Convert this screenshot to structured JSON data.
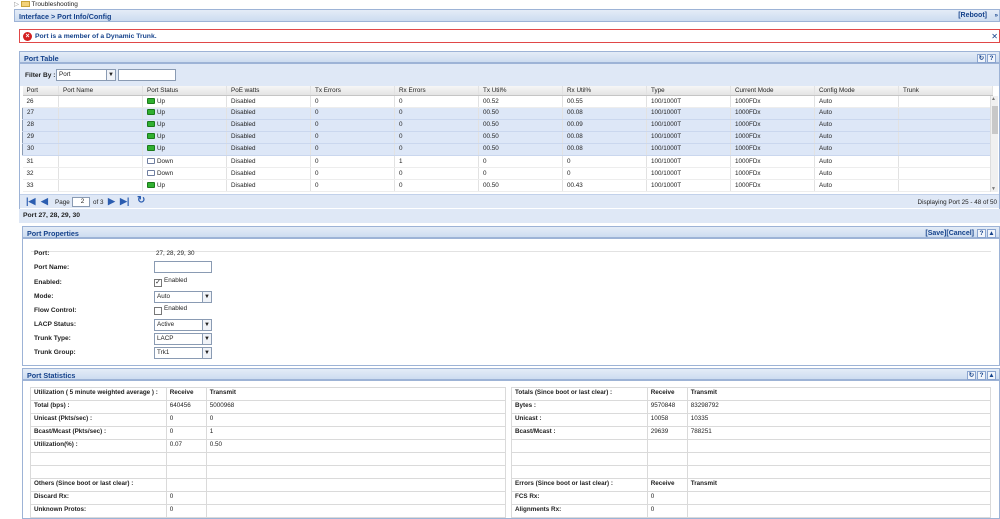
{
  "tree": {
    "item": "Troubleshooting"
  },
  "header": {
    "breadcrumb": "Interface > Port Info/Config",
    "reboot": "[Reboot]"
  },
  "alert": {
    "message": "Port is a member of a Dynamic Trunk."
  },
  "port_table": {
    "title": "Port Table",
    "filter_label": "Filter By :",
    "filter_value": "Port",
    "columns": [
      "Port",
      "Port Name",
      "Port Status",
      "PoE watts",
      "Tx Errors",
      "Rx Errors",
      "Tx Util%",
      "Rx Util%",
      "Type",
      "Current Mode",
      "Config Mode",
      "Trunk"
    ],
    "rows": [
      {
        "port": "26",
        "name": "",
        "status": "Up",
        "poe": "Disabled",
        "tx_err": "0",
        "rx_err": "0",
        "tx_util": "00.52",
        "rx_util": "00.55",
        "type": "100/1000T",
        "cur": "1000FDx",
        "cfg": "Auto",
        "trunk": "",
        "selected": false
      },
      {
        "port": "27",
        "name": "",
        "status": "Up",
        "poe": "Disabled",
        "tx_err": "0",
        "rx_err": "0",
        "tx_util": "00.50",
        "rx_util": "00.08",
        "type": "100/1000T",
        "cur": "1000FDx",
        "cfg": "Auto",
        "trunk": "",
        "selected": true
      },
      {
        "port": "28",
        "name": "",
        "status": "Up",
        "poe": "Disabled",
        "tx_err": "0",
        "rx_err": "0",
        "tx_util": "00.50",
        "rx_util": "00.09",
        "type": "100/1000T",
        "cur": "1000FDx",
        "cfg": "Auto",
        "trunk": "",
        "selected": true
      },
      {
        "port": "29",
        "name": "",
        "status": "Up",
        "poe": "Disabled",
        "tx_err": "0",
        "rx_err": "0",
        "tx_util": "00.50",
        "rx_util": "00.08",
        "type": "100/1000T",
        "cur": "1000FDx",
        "cfg": "Auto",
        "trunk": "",
        "selected": true
      },
      {
        "port": "30",
        "name": "",
        "status": "Up",
        "poe": "Disabled",
        "tx_err": "0",
        "rx_err": "0",
        "tx_util": "00.50",
        "rx_util": "00.08",
        "type": "100/1000T",
        "cur": "1000FDx",
        "cfg": "Auto",
        "trunk": "",
        "selected": true
      },
      {
        "port": "31",
        "name": "",
        "status": "Down",
        "poe": "Disabled",
        "tx_err": "0",
        "rx_err": "1",
        "tx_util": "0",
        "rx_util": "0",
        "type": "100/1000T",
        "cur": "1000FDx",
        "cfg": "Auto",
        "trunk": "",
        "selected": false
      },
      {
        "port": "32",
        "name": "",
        "status": "Down",
        "poe": "Disabled",
        "tx_err": "0",
        "rx_err": "0",
        "tx_util": "0",
        "rx_util": "0",
        "type": "100/1000T",
        "cur": "1000FDx",
        "cfg": "Auto",
        "trunk": "",
        "selected": false
      },
      {
        "port": "33",
        "name": "",
        "status": "Up",
        "poe": "Disabled",
        "tx_err": "0",
        "rx_err": "0",
        "tx_util": "00.50",
        "rx_util": "00.43",
        "type": "100/1000T",
        "cur": "1000FDx",
        "cfg": "Auto",
        "trunk": "",
        "selected": false
      }
    ],
    "page_label": "Page",
    "page_value": "2",
    "page_of": "of 3",
    "display_info": "Displaying Port 25 - 48 of 50"
  },
  "selection": {
    "title": "Port 27, 28, 29, 30"
  },
  "props": {
    "title": "Port Properties",
    "save": "[Save]",
    "cancel": "[Cancel]",
    "port_label": "Port:",
    "port_value": "27, 28, 29, 30",
    "name_label": "Port Name:",
    "name_value": "",
    "enabled_label": "Enabled:",
    "enabled_text": "Enabled",
    "mode_label": "Mode:",
    "mode_value": "Auto",
    "flow_label": "Flow Control:",
    "flow_text": "Enabled",
    "lacp_label": "LACP Status:",
    "lacp_value": "Active",
    "trunk_type_label": "Trunk Type:",
    "trunk_type_value": "LACP",
    "trunk_group_label": "Trunk Group:",
    "trunk_group_value": "Trk1"
  },
  "stats": {
    "title": "Port Statistics",
    "util_head": "Utilization ( 5 minute weighted average ) :",
    "receive": "Receive",
    "transmit": "Transmit",
    "total_bps": "Total (bps) :",
    "total_rx": "640456",
    "total_tx": "5000968",
    "unicast_pps": "Unicast (Pkts/sec) :",
    "uni_rx": "0",
    "uni_tx": "0",
    "bcast_pps": "Bcast/Mcast (Pkts/sec) :",
    "bc_rx": "0",
    "bc_tx": "1",
    "util_pct": "Utilization(%) :",
    "util_rx": "0.07",
    "util_tx": "0.50",
    "totals_head": "Totals (Since boot or last clear) :",
    "bytes": "Bytes :",
    "bytes_rx": "9570848",
    "bytes_tx": "83298792",
    "unicast": "Unicast :",
    "unicast_rx": "10058",
    "unicast_tx": "10335",
    "bcast": "Bcast/Mcast :",
    "bcast_rx": "29639",
    "bcast_tx": "788251",
    "others_head": "Others (Since boot or last clear) :",
    "discard": "Discard Rx:",
    "discard_v": "0",
    "unknown": "Unknown Protos:",
    "unknown_v": "0",
    "errors_head": "Errors (Since boot or last clear) :",
    "fcs": "FCS Rx:",
    "fcs_v": "0",
    "align": "Alignments Rx:",
    "align_v": "0"
  }
}
